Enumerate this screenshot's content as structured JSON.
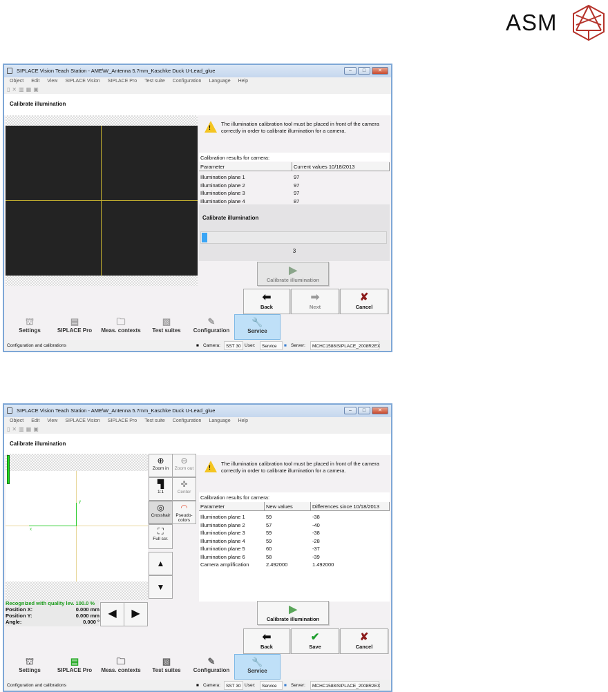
{
  "logo": {
    "text": "ASM",
    "color": "#b5322a"
  },
  "windows": [
    {
      "title": "SIPLACE Vision Teach Station - AME\\W_Antenna 5.7mm_Kaschke Duck U-Lead_glue",
      "menu": [
        "Object",
        "Edit",
        "View",
        "SIPLACE Vision",
        "SIPLACE Pro",
        "Test suite",
        "Configuration",
        "Language",
        "Help"
      ],
      "page_title": "Calibrate illumination",
      "warning": "The illumination calibration tool must be placed in front of the camera correctly in order to calibrate illumination for a camera.",
      "results_label": "Calibration results for camera:",
      "columns": [
        "Parameter",
        "Current values 10/18/2013"
      ],
      "rows": [
        [
          "Illumination plane 1",
          "97"
        ],
        [
          "Illumination plane 2",
          "97"
        ],
        [
          "Illumination plane 3",
          "97"
        ],
        [
          "Illumination plane 4",
          "87"
        ]
      ],
      "progress": {
        "title": "Calibrate illumination",
        "value": "3",
        "fraction": 0.03
      },
      "calibrate_label": "Calibrate illumination",
      "buttons": {
        "back": "Back",
        "next": "Next",
        "cancel": "Cancel"
      },
      "tabs": [
        "Settings",
        "SIPLACE Pro",
        "Meas. contexts",
        "Test suites",
        "Configuration",
        "Service"
      ],
      "status": {
        "text": "Configuration and calibrations",
        "camera_label": "Camera:",
        "camera": "SST 30",
        "user_label": "User:",
        "user": "Service",
        "server_label": "Server:",
        "server": "MCHC1588\\SIPLACE_2008R2EX"
      }
    },
    {
      "title": "SIPLACE Vision Teach Station - AME\\W_Antenna 5.7mm_Kaschke Duck U-Lead_glue",
      "menu": [
        "Object",
        "Edit",
        "View",
        "SIPLACE Vision",
        "SIPLACE Pro",
        "Test suite",
        "Configuration",
        "Language",
        "Help"
      ],
      "page_title": "Calibrate illumination",
      "tools": {
        "zoom_in": "Zoom in",
        "zoom_out": "Zoom out",
        "one_to_one": "1:1",
        "center": "Center",
        "crosshair": "Crosshair",
        "pseudo": "Pseudo-colors",
        "full": "Full scr."
      },
      "axes": {
        "x": "x",
        "y": "y"
      },
      "recognition": {
        "quality": "Recognized with quality lev.  100.0 %",
        "pos_x_label": "Position X:",
        "pos_x": "0.000 mm",
        "pos_y_label": "Position Y:",
        "pos_y": "0.000 mm",
        "angle_label": "Angle:",
        "angle": "0.000 °"
      },
      "warning": "The illumination calibration tool must be placed in front of the camera correctly in order to calibrate illumination for a camera.",
      "results_label": "Calibration results for camera:",
      "columns": [
        "Parameter",
        "New values",
        "Differences since 10/18/2013"
      ],
      "rows": [
        [
          "Illumination plane 1",
          "59",
          "-38"
        ],
        [
          "Illumination plane 2",
          "57",
          "-40"
        ],
        [
          "Illumination plane 3",
          "59",
          "-38"
        ],
        [
          "Illumination plane 4",
          "59",
          "-28"
        ],
        [
          "Illumination plane 5",
          "60",
          "-37"
        ],
        [
          "Illumination plane 6",
          "58",
          "-39"
        ],
        [
          "Camera amplification",
          "2.492000",
          "1.492000"
        ]
      ],
      "calibrate_label": "Calibrate illumination",
      "buttons": {
        "back": "Back",
        "save": "Save",
        "cancel": "Cancel"
      },
      "tabs": [
        "Settings",
        "SIPLACE Pro",
        "Meas. contexts",
        "Test suites",
        "Configuration",
        "Service"
      ],
      "status": {
        "text": "Configuration and calibrations",
        "camera_label": "Camera:",
        "camera": "SST 30",
        "user_label": "User:",
        "user": "Service",
        "server_label": "Server:",
        "server": "MCHC1588\\SIPLACE_2008R2EX"
      }
    }
  ]
}
